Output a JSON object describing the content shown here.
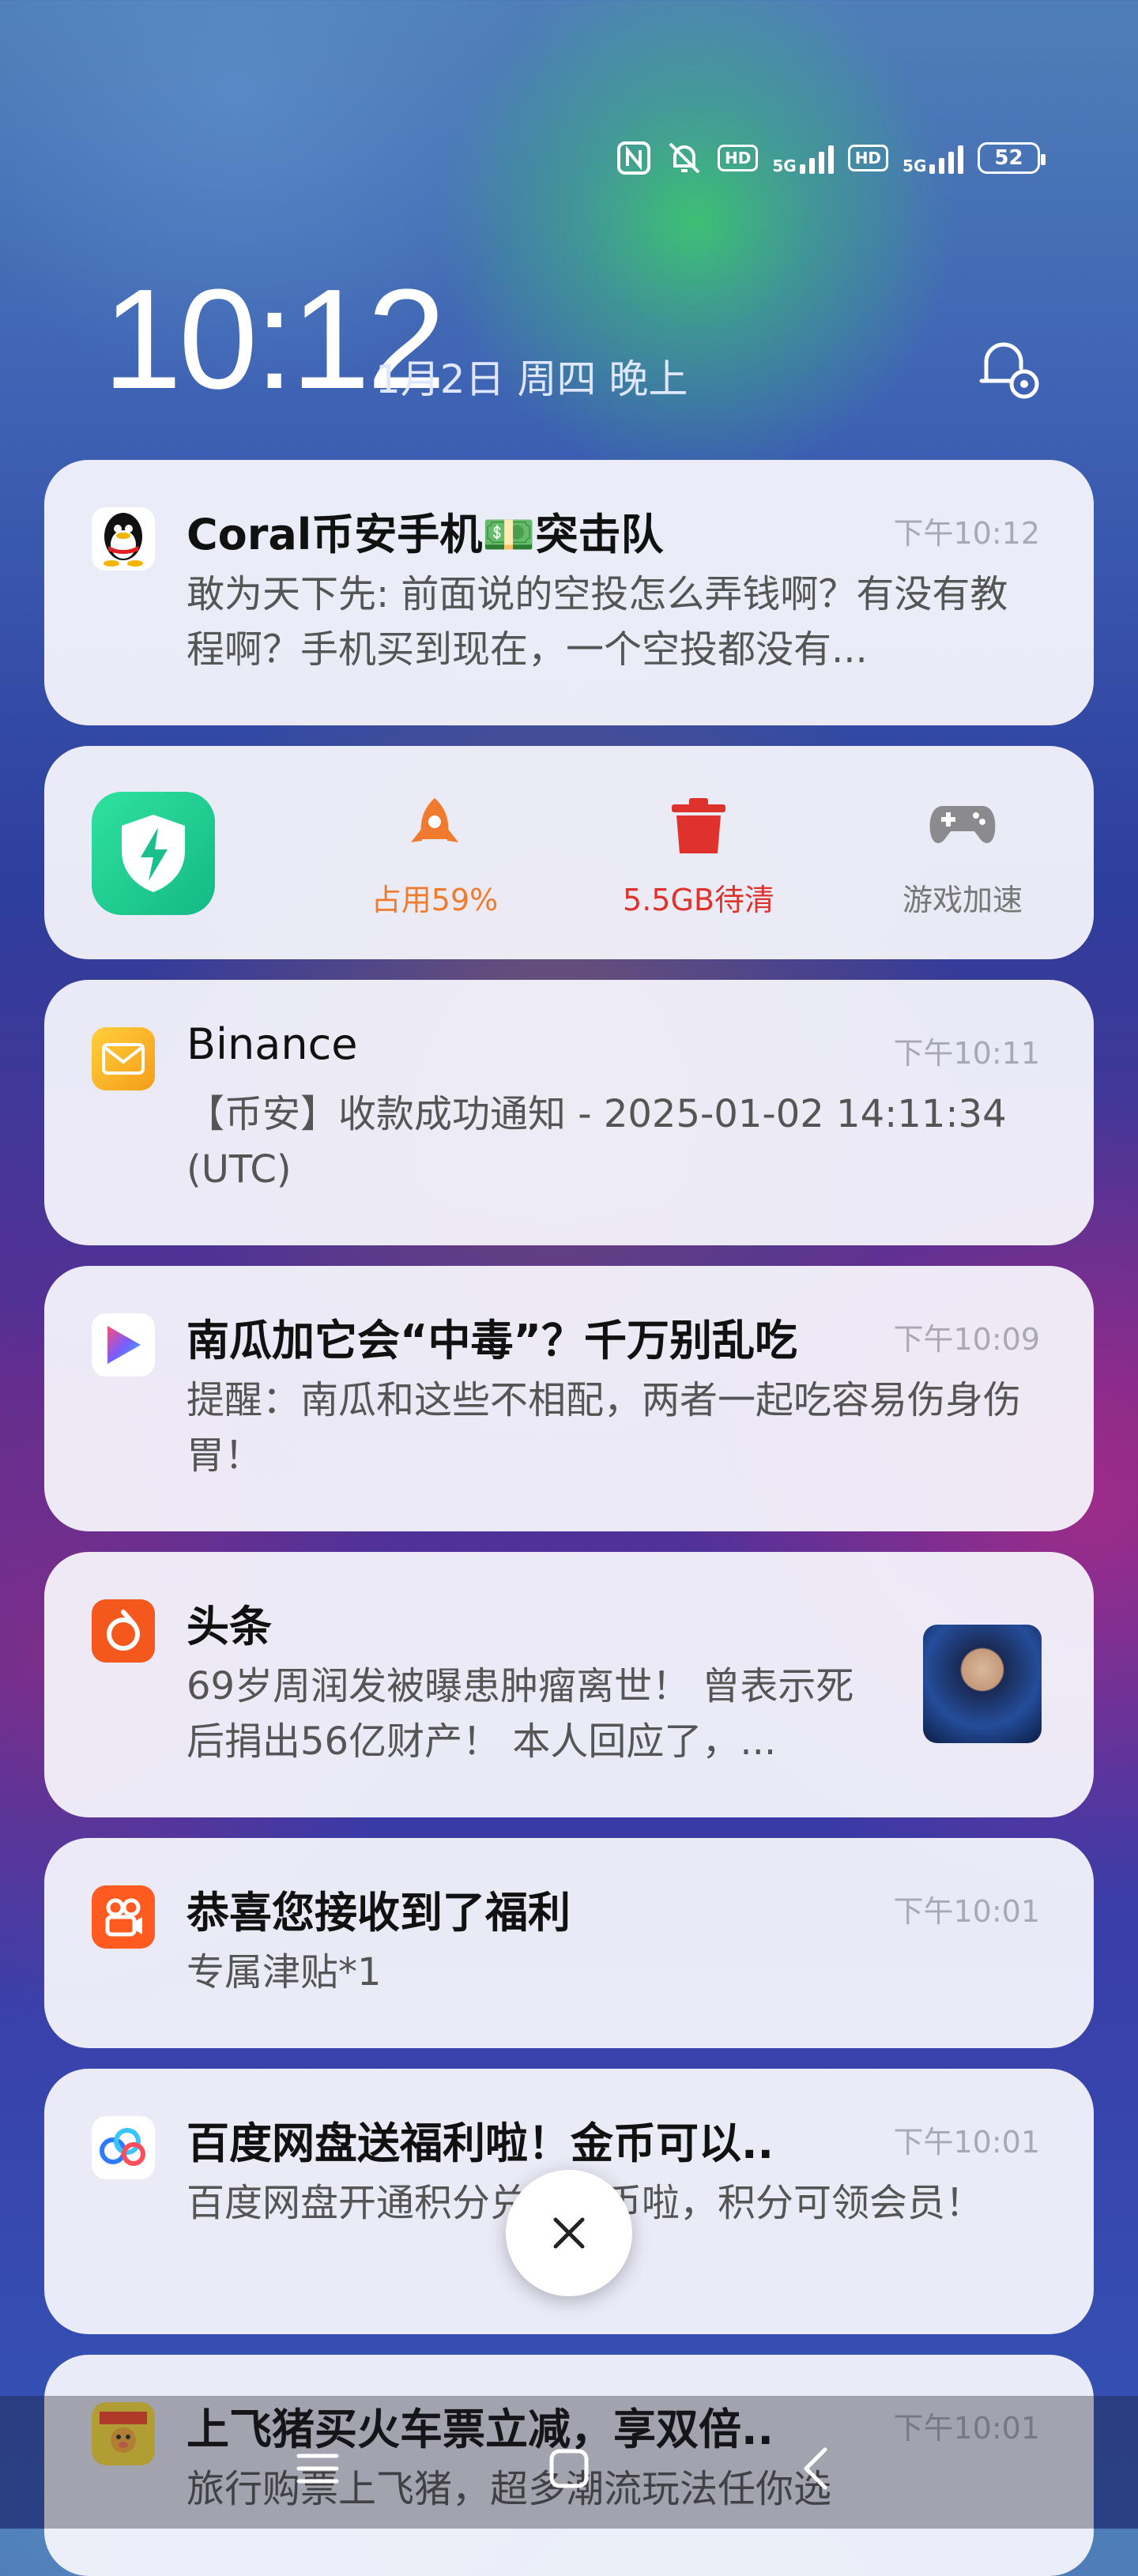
{
  "status_bar": {
    "nfc_icon": "nfc-icon",
    "mute_icon": "bell-off-icon",
    "sim1_hd": "HD",
    "sim1_network": "5G",
    "sim2_hd": "HD",
    "sim2_network": "5G",
    "battery": "52"
  },
  "lockscreen": {
    "time": "10:12",
    "date": "1月2日 周四 晚上",
    "settings_icon": "notification-settings-icon"
  },
  "notifications": [
    {
      "app_icon": "qq-icon",
      "title": "Coral币安手机💵突击队",
      "time": "下午10:12",
      "body": "敢为天下先: 前面说的空投怎么弄钱啊？有没有教程啊？手机买到现在，一个空投都没有..."
    },
    {
      "app_icon": "mail-icon",
      "title": "Binance",
      "time": "下午10:11",
      "body": "【币安】收款成功通知 - 2025-01-02 14:11:34 (UTC)"
    },
    {
      "app_icon": "video-play-icon",
      "title": "南瓜加它会“中毒”？千万别乱吃",
      "time": "下午10:09",
      "body": "提醒：南瓜和这些不相配，两者一起吃容易伤身伤胃！"
    },
    {
      "app_icon": "toutiao-icon",
      "title": "头条",
      "time": "",
      "body": "69岁周润发被曝患肿瘤离世！ 曾表示死后捐出56亿财产！ 本人回应了，..."
    },
    {
      "app_icon": "kuaishou-icon",
      "title": "恭喜您接收到了福利",
      "time": "下午10:01",
      "body": "专属津贴*1"
    },
    {
      "app_icon": "baidu-netdisk-icon",
      "title": "百度网盘送福利啦！金币可以..",
      "time": "下午10:01",
      "body": "百度网盘开通积分兑换金币啦，积分可领会员！"
    },
    {
      "app_icon": "fliggy-icon",
      "title": "上飞猪买火车票立减，享双倍..",
      "time": "下午10:01",
      "body": "旅行购票上飞猪，超多潮流玩法任你选"
    }
  ],
  "security_widget": {
    "app_icon": "security-shield-icon",
    "items": [
      {
        "icon": "rocket-icon",
        "label": "占用59%",
        "color": "#f07b2e"
      },
      {
        "icon": "trash-icon",
        "label": "5.5GB待清",
        "color": "#e0322c"
      },
      {
        "icon": "gamepad-icon",
        "label": "游戏加速",
        "color": "#777777"
      }
    ]
  },
  "controls": {
    "clear_icon": "close-icon",
    "nav_menu_icon": "menu-icon",
    "nav_home_icon": "home-icon",
    "nav_back_icon": "back-icon"
  }
}
